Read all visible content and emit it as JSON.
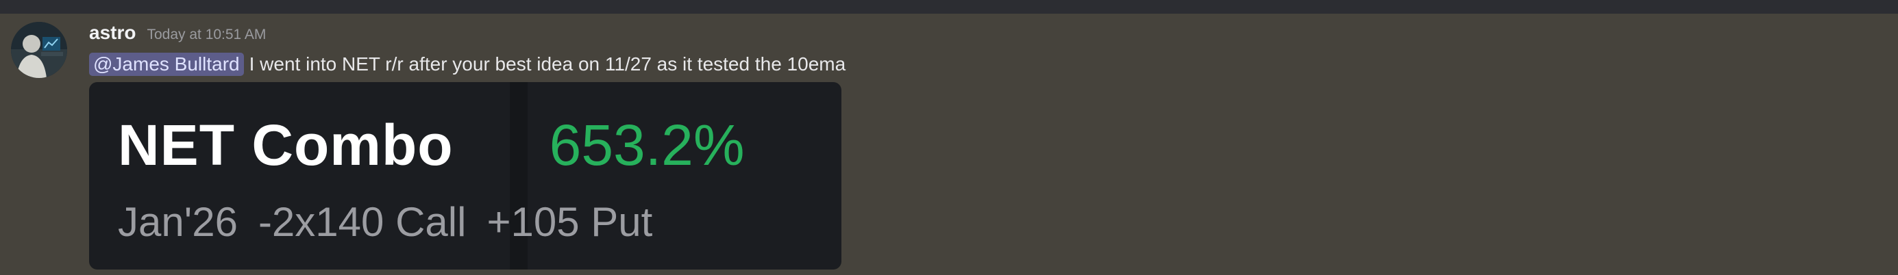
{
  "message": {
    "username": "astro",
    "timestamp": "Today at 10:51 AM",
    "mention": "@James Bulltard",
    "text": "I went into NET r/r after your best idea on 11/27 as it tested the 10ema",
    "embed": {
      "title": "NET Combo",
      "percent": "653.2%",
      "expiry": "Jan'26",
      "leg1": "-2x140 Call",
      "leg2": "+105 Put"
    }
  },
  "colors": {
    "background": "#46433c",
    "top_bar": "#2c2d32",
    "mention_bg": "#5d5d8a",
    "embed_bg": "#1b1d21",
    "gain_green": "#27b15c"
  },
  "icons": {
    "avatar": "user-avatar"
  }
}
